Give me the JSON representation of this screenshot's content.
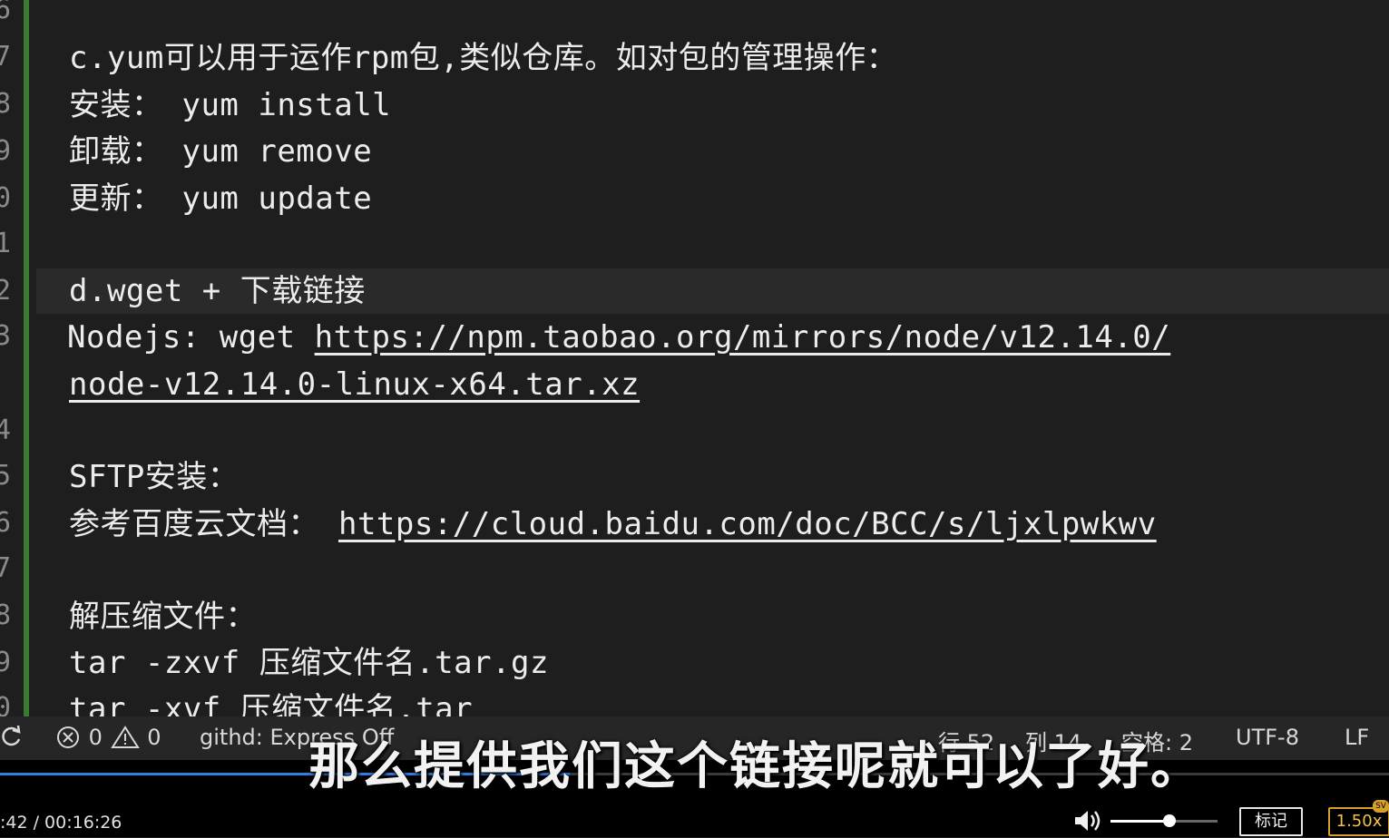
{
  "editor": {
    "line_numbers": [
      "6",
      "7",
      "8",
      "9",
      "0",
      "1",
      "2",
      "3",
      "4",
      "5",
      "6",
      "7",
      "8",
      "9",
      "0"
    ],
    "lines": {
      "l7": "c.yum可以用于运作rpm包,类似仓库。如对包的管理操作：",
      "l8": "安装： yum install",
      "l9": "卸载： yum remove",
      "l10": "更新： yum update",
      "l12": "d.wget + 下载链接",
      "l13_prefix": "Nodejs: wget ",
      "l13_link": "https://npm.taobao.org/mirrors/node/v12.14.0/",
      "l13b_link": "node-v12.14.0-linux-x64.tar.xz",
      "l15": "SFTP安装：",
      "l16_prefix": "参考百度云文档： ",
      "l16_link": "https://cloud.baidu.com/doc/BCC/s/ljxlpwkwv",
      "l18": "解压缩文件：",
      "l19": "tar -zxvf 压缩文件名.tar.gz",
      "l20": "tar -xvf 压缩文件名.tar"
    }
  },
  "statusbar": {
    "errors": "0",
    "warnings": "0",
    "extension": "githd: Express Off",
    "line": "行 52",
    "col": "列 14",
    "spaces": "空格: 2",
    "encoding": "UTF-8",
    "eol": "LF"
  },
  "player": {
    "subtitle": "那么提供我们这个链接呢就可以了好。",
    "time": ":42 / 00:16:26",
    "progress_fraction": 0.41,
    "volume_fraction": 0.55,
    "mark_label": "标记",
    "speed_label": "1.50x",
    "badge": "SV"
  },
  "colors": {
    "accent": "#2f7fe0",
    "gutter": "#3a7a34",
    "speed": "#d6a02a"
  }
}
